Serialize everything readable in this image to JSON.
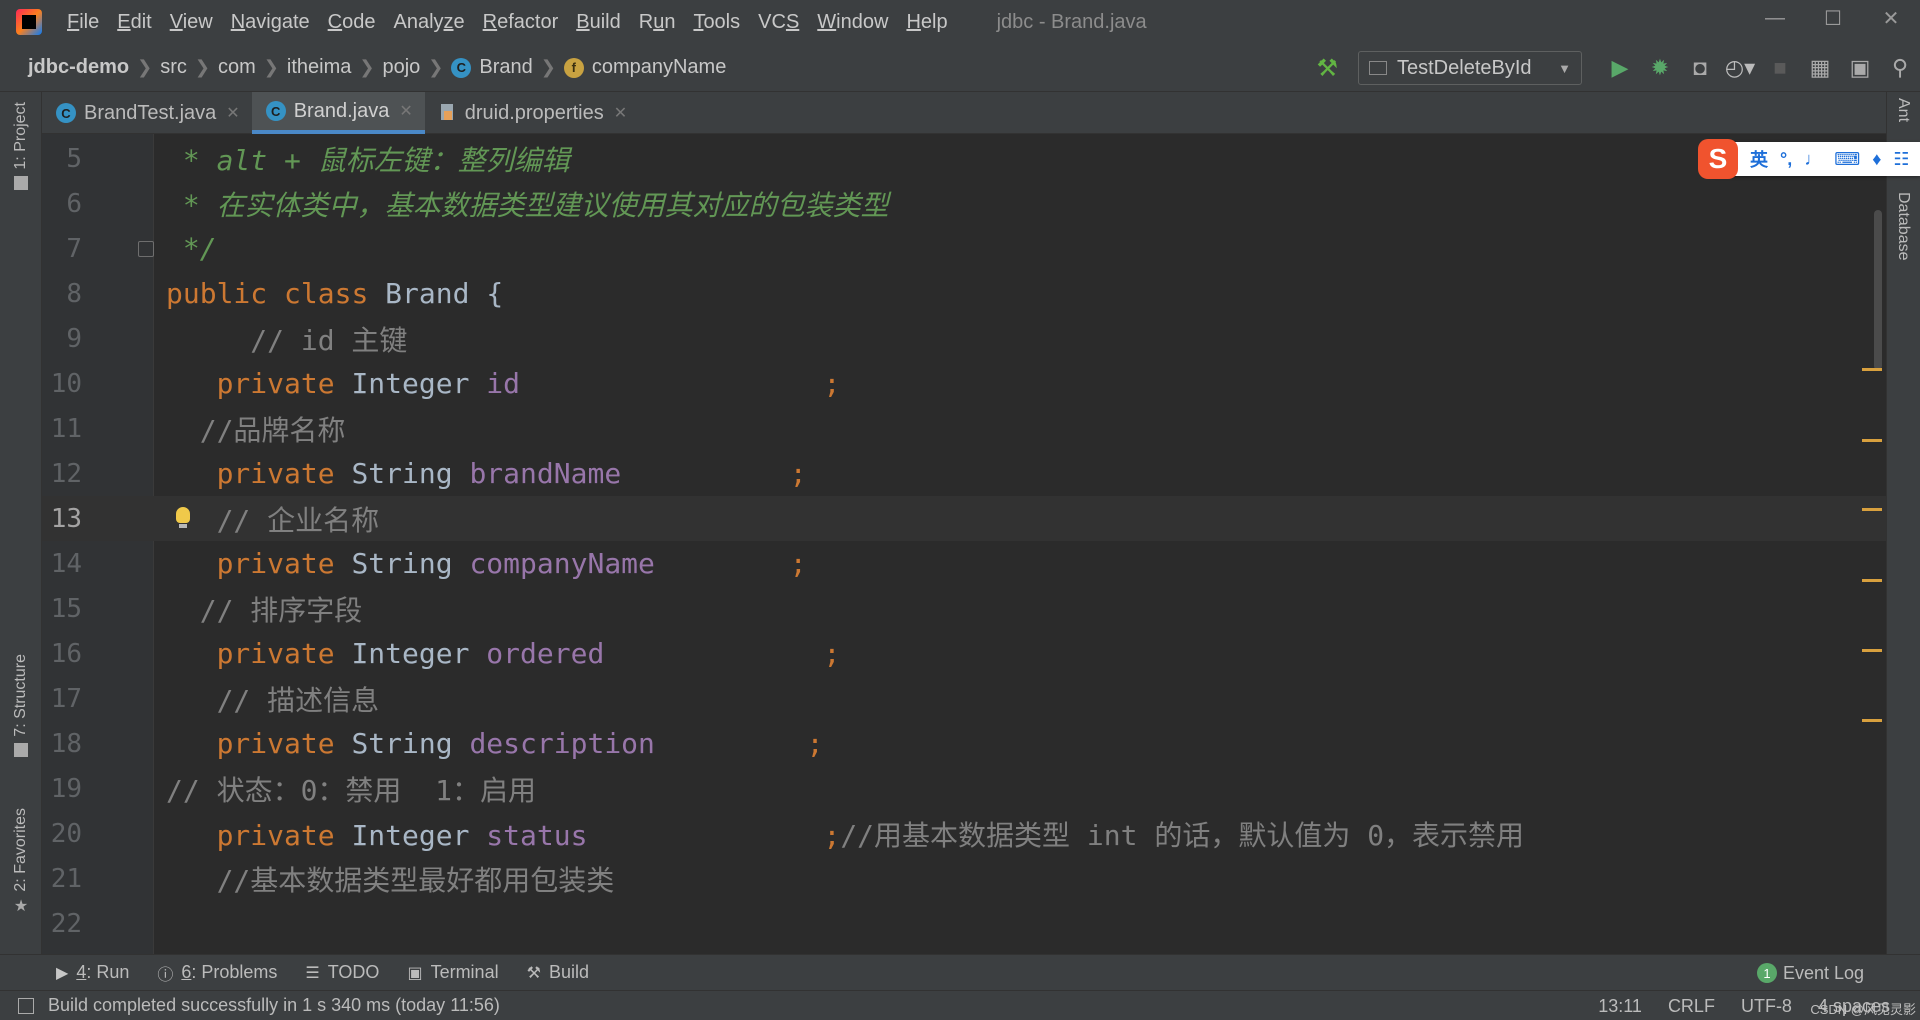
{
  "window": {
    "title": "jdbc - Brand.java",
    "menu": [
      {
        "pre": "",
        "u": "F",
        "post": "ile"
      },
      {
        "pre": "",
        "u": "E",
        "post": "dit"
      },
      {
        "pre": "",
        "u": "V",
        "post": "iew"
      },
      {
        "pre": "",
        "u": "N",
        "post": "avigate"
      },
      {
        "pre": "",
        "u": "C",
        "post": "ode"
      },
      {
        "pre": "Analy",
        "u": "z",
        "post": "e"
      },
      {
        "pre": "",
        "u": "R",
        "post": "efactor"
      },
      {
        "pre": "",
        "u": "B",
        "post": "uild"
      },
      {
        "pre": "R",
        "u": "u",
        "post": "n"
      },
      {
        "pre": "",
        "u": "T",
        "post": "ools"
      },
      {
        "pre": "VC",
        "u": "S",
        "post": ""
      },
      {
        "pre": "",
        "u": "W",
        "post": "indow"
      },
      {
        "pre": "",
        "u": "H",
        "post": "elp"
      }
    ]
  },
  "breadcrumb": {
    "project": "jdbc-demo",
    "items": [
      "src",
      "com",
      "itheima",
      "pojo"
    ],
    "class_name": "Brand",
    "field_name": "companyName",
    "class_icon": "C",
    "field_icon": "f"
  },
  "toolbar": {
    "run_config": "TestDeleteById"
  },
  "tabs": [
    {
      "label": "BrandTest.java",
      "icon": "class-icon",
      "active": false
    },
    {
      "label": "Brand.java",
      "icon": "class-icon",
      "active": true
    },
    {
      "label": "druid.properties",
      "icon": "properties-icon",
      "active": false
    }
  ],
  "side_tools": {
    "project": "1: Project",
    "structure": "7: Structure",
    "favorites": "2: Favorites",
    "database": "Database",
    "ant": "Ant"
  },
  "editor": {
    "current_line": 13,
    "lines": [
      {
        "n": "5",
        "text": " * alt + 鼠标左键：整列编辑"
      },
      {
        "n": "6",
        "text": " * 在实体类中，基本数据类型建议使用其对应的包装类型"
      },
      {
        "n": "7",
        "text": " */"
      },
      {
        "n": "8",
        "kw1": "public ",
        "kw2": "class ",
        "name": "Brand {"
      },
      {
        "n": "9",
        "comment": "     // id 主键"
      },
      {
        "n": "10",
        "kw": "   private ",
        "type": "Integer ",
        "field": "id",
        "tail": "                  ;"
      },
      {
        "n": "11",
        "comment": "  //品牌名称"
      },
      {
        "n": "12",
        "kw": "   private ",
        "type": "String ",
        "field": "brandName",
        "tail": "          ;"
      },
      {
        "n": "13",
        "comment": "   // 企业名称"
      },
      {
        "n": "14",
        "kw": "   private ",
        "type": "String ",
        "field": "companyName",
        "tail": "        ;"
      },
      {
        "n": "15",
        "comment": "  // 排序字段"
      },
      {
        "n": "16",
        "kw": "   private ",
        "type": "Integer ",
        "field": "ordered",
        "tail": "             ;"
      },
      {
        "n": "17",
        "comment": "   // 描述信息"
      },
      {
        "n": "18",
        "kw": "   private ",
        "type": "String ",
        "field": "description",
        "tail": "         ;"
      },
      {
        "n": "19",
        "comment": "// 状态：0：禁用  1：启用"
      },
      {
        "n": "20",
        "kw": "   private ",
        "type": "Integer ",
        "field": "status",
        "tail": "              ;",
        "trail_comment": "//用基本数据类型 int 的话，默认值为 0，表示禁用"
      },
      {
        "n": "21",
        "comment": "   //基本数据类型最好都用包装类"
      },
      {
        "n": "22",
        "comment": ""
      }
    ]
  },
  "ime": {
    "logo": "S",
    "lang": "英"
  },
  "bottom_tools": [
    {
      "prefix": "4",
      "label": ": Run",
      "icon": "run-icon"
    },
    {
      "prefix": "6",
      "label": ": Problems",
      "icon": "problems-icon"
    },
    {
      "prefix": "",
      "label": "TODO",
      "icon": "todo-icon"
    },
    {
      "prefix": "",
      "label": "Terminal",
      "icon": "terminal-icon"
    },
    {
      "prefix": "",
      "label": "Build",
      "icon": "build-icon"
    }
  ],
  "event_log": {
    "count": "1",
    "label": "Event Log"
  },
  "status": {
    "message": "Build completed successfully in 1 s 340 ms (today 11:56)",
    "position": "13:11",
    "line_sep": "CRLF",
    "encoding": "UTF-8",
    "indent": "4 spaces"
  },
  "watermark": "CSDN @风见灵影",
  "colors": {
    "keyword": "#cc7832",
    "field": "#9876aa",
    "comment": "#808080",
    "doc_comment": "#629755",
    "text": "#a9b7c6",
    "warning_mark": "#d8a03e"
  }
}
